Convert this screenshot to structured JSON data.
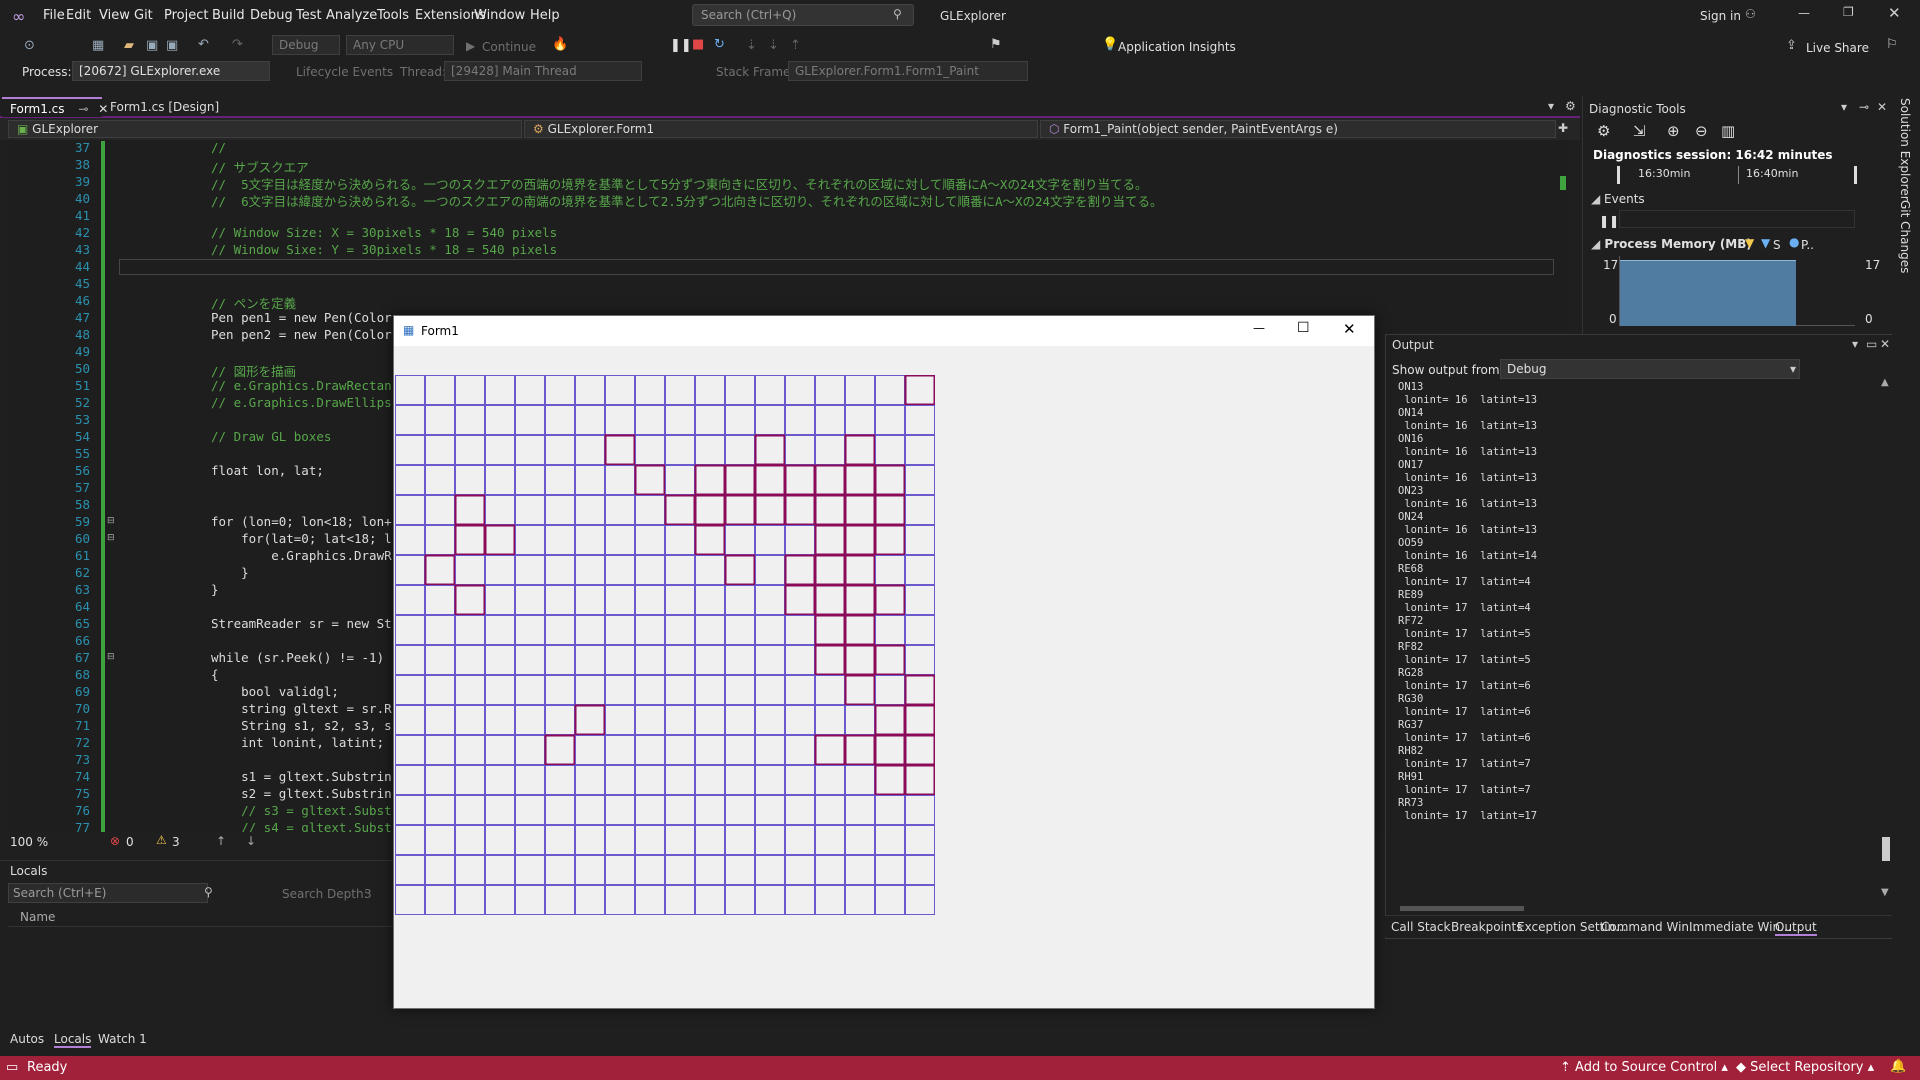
{
  "menu": [
    "File",
    "Edit",
    "View",
    "Git",
    "Project",
    "Build",
    "Debug",
    "Test",
    "Analyze",
    "Tools",
    "Extensions",
    "Window",
    "Help"
  ],
  "search": {
    "placeholder": "Search (Ctrl+Q)"
  },
  "app_title": "GLExplorer",
  "sign_in": "Sign in",
  "toolbar": {
    "config": "Debug",
    "platform": "Any CPU",
    "continue_label": "Continue",
    "app_insights": "Application Insights",
    "live_share": "Live Share"
  },
  "debug_location": {
    "process_label": "Process:",
    "process_value": "[20672] GLExplorer.exe",
    "lifecycle": "Lifecycle Events",
    "thread_label": "Thread:",
    "thread_value": "[29428] Main Thread",
    "stack_label": "Stack Frame:",
    "stack_value": "GLExplorer.Form1.Form1_Paint"
  },
  "doc_tabs": [
    "Form1.cs",
    "Form1.cs [Design]"
  ],
  "nav": {
    "project": "GLExplorer",
    "class": "GLExplorer.Form1",
    "member": "Form1_Paint(object sender, PaintEventArgs e)"
  },
  "code_lines": [
    {
      "n": "37",
      "t": "//",
      "c": "cmt"
    },
    {
      "n": "38",
      "t": "// サブスクエア",
      "c": "cmt"
    },
    {
      "n": "39",
      "t": "//  5文字目は経度から決められる。一つのスクエアの西端の境界を基準として5分ずつ東向きに区切り、それぞれの区域に対して順番にA～Xの24文字を割り当てる。",
      "c": "cmt"
    },
    {
      "n": "40",
      "t": "//  6文字目は緯度から決められる。一つのスクエアの南端の境界を基準として2.5分ずつ北向きに区切り、それぞれの区域に対して順番にA～Xの24文字を割り当てる。",
      "c": "cmt"
    },
    {
      "n": "41",
      "t": "",
      "c": ""
    },
    {
      "n": "42",
      "t": "// Window Size: X = 30pixels * 18 = 540 pixels",
      "c": "cmt"
    },
    {
      "n": "43",
      "t": "// Window Sixe: Y = 30pixels * 18 = 540 pixels",
      "c": "cmt"
    },
    {
      "n": "44",
      "t": "",
      "c": ""
    },
    {
      "n": "45",
      "t": "",
      "c": ""
    },
    {
      "n": "46",
      "t": "// ペンを定義",
      "c": "cmt"
    },
    {
      "n": "47",
      "t": "Pen pen1 = new Pen(Color.",
      "c": ""
    },
    {
      "n": "48",
      "t": "Pen pen2 = new Pen(Color.",
      "c": ""
    },
    {
      "n": "49",
      "t": "",
      "c": ""
    },
    {
      "n": "50",
      "t": "// 図形を描画",
      "c": "cmt"
    },
    {
      "n": "51",
      "t": "// e.Graphics.DrawRectan",
      "c": "cmt"
    },
    {
      "n": "52",
      "t": "// e.Graphics.DrawEllips",
      "c": "cmt"
    },
    {
      "n": "53",
      "t": "",
      "c": ""
    },
    {
      "n": "54",
      "t": "// Draw GL boxes",
      "c": "cmt"
    },
    {
      "n": "55",
      "t": "",
      "c": ""
    },
    {
      "n": "56",
      "t": "float lon, lat;",
      "c": ""
    },
    {
      "n": "57",
      "t": "",
      "c": ""
    },
    {
      "n": "58",
      "t": "",
      "c": ""
    },
    {
      "n": "59",
      "t": "for (lon=0; lon<18; lon+",
      "c": ""
    },
    {
      "n": "60",
      "t": "    for(lat=0; lat<18; l",
      "c": ""
    },
    {
      "n": "61",
      "t": "        e.Graphics.DrawR",
      "c": ""
    },
    {
      "n": "62",
      "t": "    }",
      "c": ""
    },
    {
      "n": "63",
      "t": "}",
      "c": ""
    },
    {
      "n": "64",
      "t": "",
      "c": ""
    },
    {
      "n": "65",
      "t": "StreamReader sr = new St",
      "c": ""
    },
    {
      "n": "66",
      "t": "",
      "c": ""
    },
    {
      "n": "67",
      "t": "while (sr.Peek() != -1)",
      "c": ""
    },
    {
      "n": "68",
      "t": "{",
      "c": ""
    },
    {
      "n": "69",
      "t": "    bool validgl;",
      "c": ""
    },
    {
      "n": "70",
      "t": "    string gltext = sr.R",
      "c": ""
    },
    {
      "n": "71",
      "t": "    String s1, s2, s3, s",
      "c": ""
    },
    {
      "n": "72",
      "t": "    int lonint, latint;",
      "c": ""
    },
    {
      "n": "73",
      "t": "",
      "c": ""
    },
    {
      "n": "74",
      "t": "    s1 = gltext.Substrin",
      "c": ""
    },
    {
      "n": "75",
      "t": "    s2 = gltext.Substrin",
      "c": ""
    },
    {
      "n": "76",
      "t": "    // s3 = gltext.Subst",
      "c": "cmt"
    },
    {
      "n": "77",
      "t": "    // s4 = gltext.Subst",
      "c": "cmt"
    }
  ],
  "editor_status": {
    "zoom": "100 %",
    "errors": "0",
    "warnings": "3"
  },
  "locals": {
    "title": "Locals",
    "search_placeholder": "Search (Ctrl+E)",
    "depth_label": "Search Depth:",
    "depth_value": "3",
    "col_name": "Name"
  },
  "bottom_tabs": [
    "Autos",
    "Locals",
    "Watch 1"
  ],
  "status": {
    "ready": "Ready",
    "source_control": "Add to Source Control",
    "repository": "Select Repository"
  },
  "diag": {
    "title": "Diagnostic Tools",
    "session": "Diagnostics session: 16:42 minutes",
    "t1": "16:30min",
    "t2": "16:40min",
    "events": "Events",
    "process_memory": "Process Memory (MB)",
    "legend_s": "S",
    "legend_p": "P..",
    "mem_max": "17",
    "mem_min": "0",
    "mem_max_r": "17",
    "mem_min_r": "0"
  },
  "output": {
    "title": "Output",
    "show_from_label": "Show output from:",
    "show_from_value": "Debug",
    "lines": "ON13\n lonint= 16  latint=13\nON14\n lonint= 16  latint=13\nON16\n lonint= 16  latint=13\nON17\n lonint= 16  latint=13\nON23\n lonint= 16  latint=13\nON24\n lonint= 16  latint=13\nOO59\n lonint= 16  latint=14\nRE68\n lonint= 17  latint=4\nRE89\n lonint= 17  latint=4\nRF72\n lonint= 17  latint=5\nRF82\n lonint= 17  latint=5\nRG28\n lonint= 17  latint=6\nRG30\n lonint= 17  latint=6\nRG37\n lonint= 17  latint=6\nRH82\n lonint= 17  latint=7\nRH91\n lonint= 17  latint=7\nRR73\n lonint= 17  latint=17",
    "tabs": [
      "Call Stack",
      "Breakpoints",
      "Exception Settin...",
      "Command Win...",
      "Immediate Win...",
      "Output"
    ]
  },
  "side_tabs": [
    "Solution Explorer",
    "Git Changes"
  ],
  "form1": {
    "title": "Form1",
    "grid": {
      "cols": 18,
      "rows": 18,
      "grid_color": "#6a5acd",
      "highlight_color": "#8b0a5a",
      "highlighted": [
        [
          17,
          0
        ],
        [
          7,
          2
        ],
        [
          12,
          2
        ],
        [
          15,
          2
        ],
        [
          8,
          3
        ],
        [
          10,
          3
        ],
        [
          11,
          3
        ],
        [
          12,
          3
        ],
        [
          13,
          3
        ],
        [
          14,
          3
        ],
        [
          15,
          3
        ],
        [
          16,
          3
        ],
        [
          2,
          4
        ],
        [
          9,
          4
        ],
        [
          10,
          4
        ],
        [
          11,
          4
        ],
        [
          12,
          4
        ],
        [
          13,
          4
        ],
        [
          14,
          4
        ],
        [
          15,
          4
        ],
        [
          16,
          4
        ],
        [
          2,
          5
        ],
        [
          3,
          5
        ],
        [
          10,
          5
        ],
        [
          14,
          5
        ],
        [
          15,
          5
        ],
        [
          16,
          5
        ],
        [
          1,
          6
        ],
        [
          11,
          6
        ],
        [
          13,
          6
        ],
        [
          14,
          6
        ],
        [
          15,
          6
        ],
        [
          2,
          7
        ],
        [
          13,
          7
        ],
        [
          14,
          7
        ],
        [
          15,
          7
        ],
        [
          16,
          7
        ],
        [
          14,
          8
        ],
        [
          15,
          8
        ],
        [
          14,
          9
        ],
        [
          15,
          9
        ],
        [
          16,
          9
        ],
        [
          15,
          10
        ],
        [
          17,
          10
        ],
        [
          6,
          11
        ],
        [
          16,
          11
        ],
        [
          17,
          11
        ],
        [
          5,
          12
        ],
        [
          14,
          12
        ],
        [
          15,
          12
        ],
        [
          16,
          12
        ],
        [
          17,
          12
        ],
        [
          16,
          13
        ],
        [
          17,
          13
        ]
      ]
    }
  }
}
